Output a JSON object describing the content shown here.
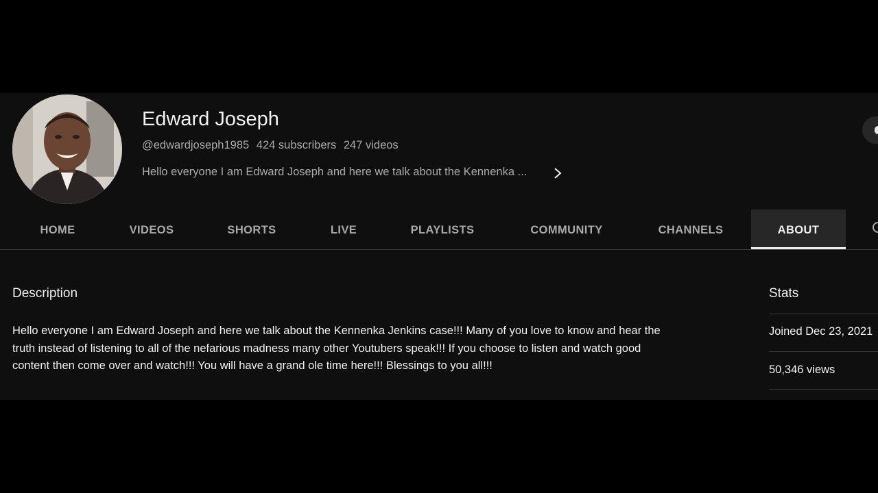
{
  "channel": {
    "name": "Edward Joseph",
    "handle": "@edwardjoseph1985",
    "subscribers": "424 subscribers",
    "videos": "247 videos",
    "tagline": "Hello everyone I am Edward Joseph and here we talk about the Kennenka ..."
  },
  "tabs": [
    {
      "label": "HOME"
    },
    {
      "label": "VIDEOS"
    },
    {
      "label": "SHORTS"
    },
    {
      "label": "LIVE"
    },
    {
      "label": "PLAYLISTS"
    },
    {
      "label": "COMMUNITY"
    },
    {
      "label": "CHANNELS"
    },
    {
      "label": "ABOUT",
      "active": true
    }
  ],
  "about": {
    "description_heading": "Description",
    "description_lines": [
      "Hello everyone I am Edward Joseph and here we talk about the Kennenka Jenkins case!!! Many of you love to know and hear the",
      "truth instead of listening to all of the nefarious madness many other Youtubers speak!!! If you choose to listen and watch good",
      "content then come over and watch!!! You will have a grand ole time here!!! Blessings to you all!!!"
    ],
    "stats_heading": "Stats",
    "joined": "Joined Dec 23, 2021",
    "views": "50,346 views"
  },
  "colors": {
    "background": "#0f0f0f",
    "letterbox": "#000000",
    "primary_text": "#f1f1f1",
    "secondary_text": "#aaaaaa",
    "active_tab_bg": "#272727"
  },
  "icons": [
    "avatar",
    "chevron-right-icon",
    "search-icon"
  ]
}
